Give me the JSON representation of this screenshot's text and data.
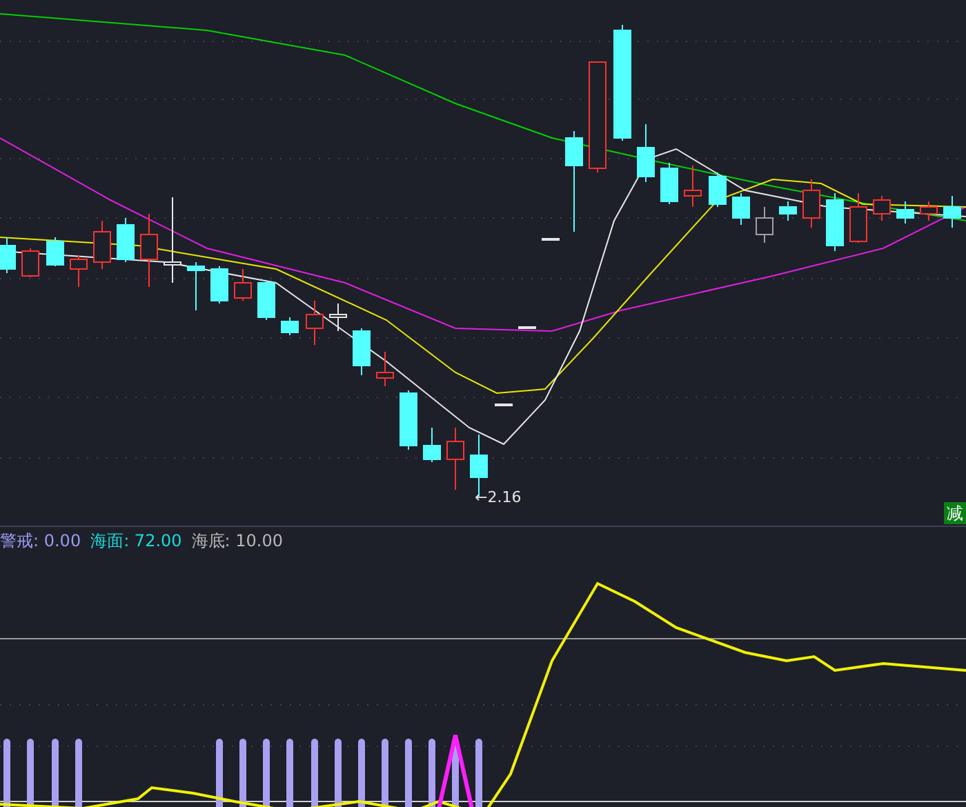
{
  "price_chart": {
    "low_marker": "←2.16",
    "signal_badge": "减"
  },
  "indicator": {
    "legend": [
      {
        "text": "警戒: 0.00",
        "color": "#9a9cf0"
      },
      {
        "text": "海面: 72.00",
        "color": "#19d9d9"
      },
      {
        "text": "海底: 10.00",
        "color": "#b8b8b8"
      }
    ]
  }
}
